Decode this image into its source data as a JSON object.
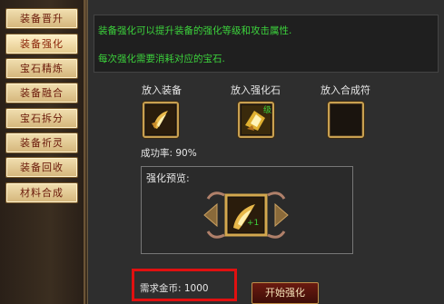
{
  "sidebar": {
    "items": [
      {
        "label": "装备晋升",
        "active": false
      },
      {
        "label": "装备强化",
        "active": true
      },
      {
        "label": "宝石精炼",
        "active": false
      },
      {
        "label": "装备融合",
        "active": false
      },
      {
        "label": "宝石拆分",
        "active": false
      },
      {
        "label": "装备祈灵",
        "active": false
      },
      {
        "label": "装备回收",
        "active": false
      },
      {
        "label": "材料合成",
        "active": false
      }
    ]
  },
  "info": {
    "line1": "装备强化可以提升装备的强化等级和攻击属性.",
    "line2": "每次强化需要消耗对应的宝石."
  },
  "slots": {
    "equip_label": "放入装备",
    "stone_label": "放入强化石",
    "stone_badge": "级",
    "synth_label": "放入合成符"
  },
  "success_rate": "成功率: 90%",
  "preview": {
    "title": "强化预览:",
    "bonus": "+1"
  },
  "gold_cost": "需求金币: 1000",
  "start_button": "开始强化",
  "colors": {
    "info_text": "#3cd23c",
    "highlight": "#e01010",
    "tab_text": "#6b1a0a"
  }
}
